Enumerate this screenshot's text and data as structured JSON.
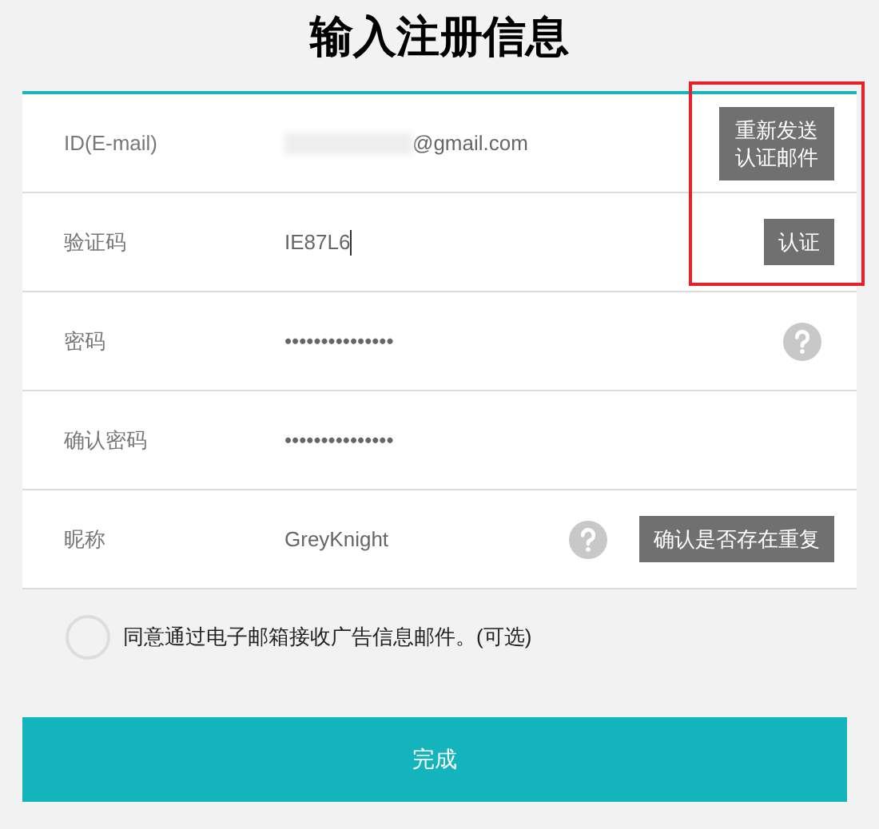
{
  "title": "输入注册信息",
  "rows": [
    {
      "kind": "stacked",
      "label": "ID(E-mail)",
      "value": "@gmail.com",
      "redacted": true,
      "focused": false,
      "help": false,
      "button": "重新发送认证邮件",
      "highlighted": true
    },
    {
      "kind": "inline",
      "label": "验证码",
      "value": "IE87L6",
      "redacted": false,
      "focused": true,
      "help": false,
      "button": "认证",
      "highlighted": true
    },
    {
      "label": "密码",
      "value": "•••••••••••••••",
      "redacted": false,
      "focused": false,
      "help": true,
      "highlighted": false
    },
    {
      "label": "确认密码",
      "value": "•••••••••••••••",
      "redacted": false,
      "focused": false,
      "help": false,
      "highlighted": false
    },
    {
      "kind": "inline",
      "label": "昵称",
      "value": "GreyKnight",
      "redacted": false,
      "focused": false,
      "help": true,
      "button": "确认是否存在重复",
      "highlighted": false
    }
  ],
  "consent": {
    "label": "同意通过电子邮箱接收广告信息邮件。(可选)",
    "checked": false
  },
  "submit": "完成"
}
